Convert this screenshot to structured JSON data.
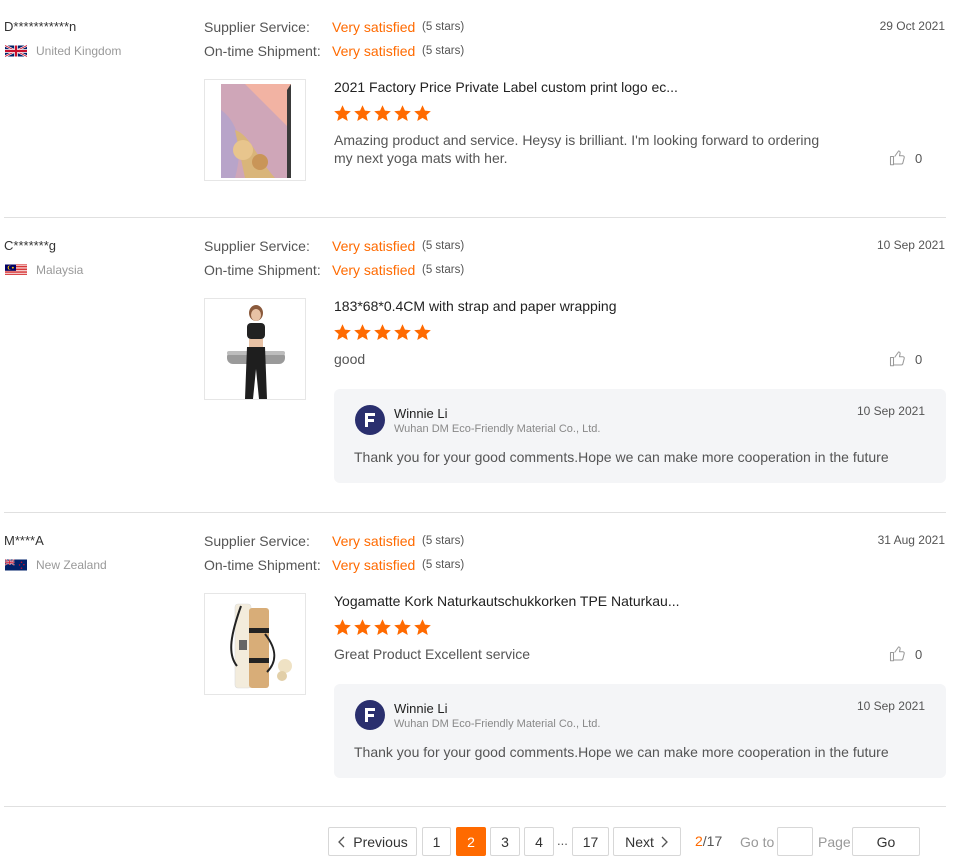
{
  "labels": {
    "supplier_service": "Supplier Service:",
    "ontime_shipment": "On-time Shipment:"
  },
  "reviews": [
    {
      "buyer": "D***********n",
      "country": "United Kingdom",
      "flag": "uk-flag",
      "date": "29 Oct 2021",
      "supplier_service": "Very satisfied",
      "supplier_service_stars": "(5 stars)",
      "ontime_shipment": "Very satisfied",
      "ontime_shipment_stars": "(5 stars)",
      "product_title": "2021 Factory Price Private Label custom print logo ec...",
      "rating": 5,
      "text": "Amazing product and service. Heysy is brilliant. I'm looking forward to ordering my next yoga mats with her.",
      "likes": "0"
    },
    {
      "buyer": "C*******g",
      "country": "Malaysia",
      "flag": "malaysia-flag",
      "date": "10 Sep 2021",
      "supplier_service": "Very satisfied",
      "supplier_service_stars": "(5 stars)",
      "ontime_shipment": "Very satisfied",
      "ontime_shipment_stars": "(5 stars)",
      "product_title": "183*68*0.4CM with strap and paper wrapping",
      "rating": 5,
      "text": "good",
      "likes": "0",
      "reply": {
        "name": "Winnie Li",
        "company": "Wuhan DM Eco-Friendly Material Co., Ltd.",
        "date": "10 Sep 2021",
        "text": "Thank you for your good comments.Hope we can make more cooperation in the future"
      }
    },
    {
      "buyer": "M****A",
      "country": "New Zealand",
      "flag": "new-zealand-flag",
      "date": "31 Aug 2021",
      "supplier_service": "Very satisfied",
      "supplier_service_stars": "(5 stars)",
      "ontime_shipment": "Very satisfied",
      "ontime_shipment_stars": "(5 stars)",
      "product_title": "Yogamatte Kork Naturkautschukkorken TPE Naturkau...",
      "rating": 5,
      "text": "Great Product Excellent service",
      "likes": "0",
      "reply": {
        "name": "Winnie Li",
        "company": "Wuhan DM Eco-Friendly Material Co., Ltd.",
        "date": "10 Sep 2021",
        "text": "Thank you for your good comments.Hope we can make more cooperation in the future"
      }
    }
  ],
  "pagination": {
    "previous": "Previous",
    "next": "Next",
    "pages": [
      "1",
      "2",
      "3",
      "4"
    ],
    "ellipsis": "...",
    "last": "17",
    "current": "2",
    "current_of": "2",
    "total_of": "/17",
    "goto_label": "Go to",
    "goto_value": "",
    "page_label": "Page",
    "go_button": "Go"
  },
  "colors": {
    "accent": "#ff6a00",
    "reply_bg": "#f4f5f7",
    "avatar_bg": "#2a2f6e"
  }
}
